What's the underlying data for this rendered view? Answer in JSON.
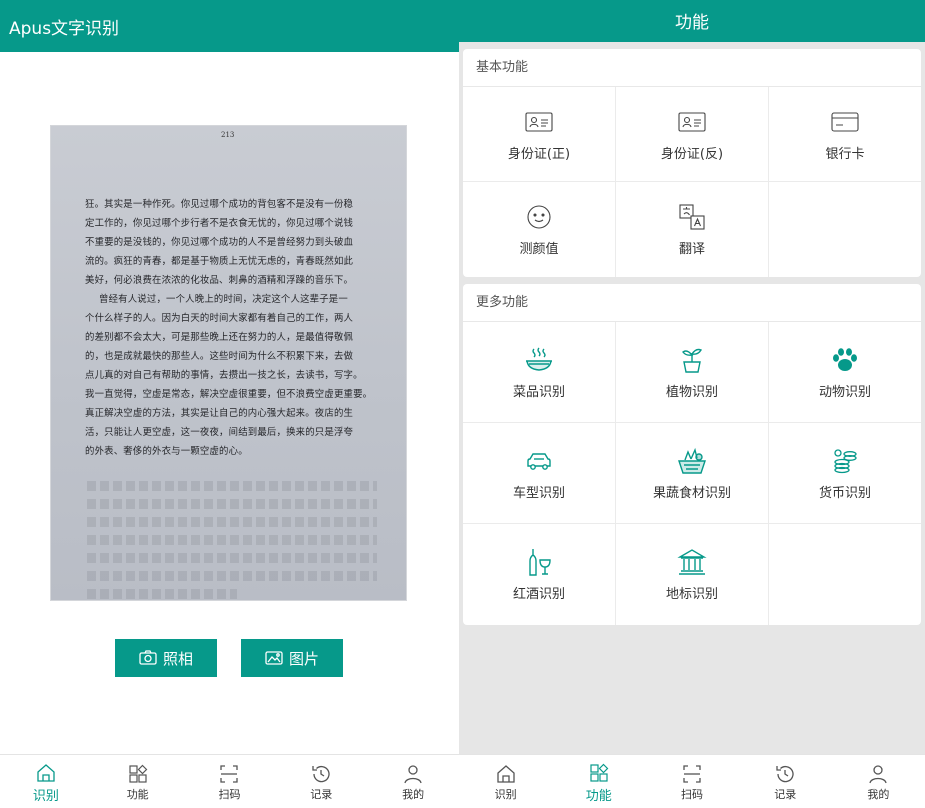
{
  "colors": {
    "accent": "#06998a",
    "panel_bg": "#e6e6e6"
  },
  "left": {
    "app_title": "Apus文字识别",
    "photo": {
      "page_number": "213",
      "lines": [
        "狂。其实是一种作死。你见过哪个成功的背包客不是没有一份稳",
        "定工作的，你见过哪个步行者不是衣食无忧的，你见过哪个说钱",
        "不重要的是没钱的，你见过哪个成功的人不是曾经努力到头破血",
        "流的。疯狂的青春，都是基于物质上无忧无虑的，青春既然如此",
        "美好，何必浪费在浓浓的化妆品、刺鼻的酒精和浮躁的音乐下。",
        "曾经有人说过，一个人晚上的时间，决定这个人这辈子是一",
        "个什么样子的人。因为白天的时间大家都有着自己的工作，两人",
        "的差别都不会太大，可是那些晚上还在努力的人，是最值得敬佩",
        "的，也是成就最快的那些人。这些时间为什么不积累下来，去做",
        "点儿真的对自己有帮助的事情，去攒出一技之长，去读书，写字。",
        "我一直觉得，空虚是常态，解决空虚很重要，但不浪费空虚更重要。",
        "真正解决空虚的方法，其实是让自己的内心强大起来。夜店的生",
        "活，只能让人更空虚，这一夜夜，间结到最后，换来的只是浮夸",
        "的外表、奢侈的外衣与一颗空虚的心。"
      ]
    },
    "buttons": {
      "camera": "照相",
      "picture": "图片"
    }
  },
  "tabs": [
    {
      "label": "识别",
      "icon": "home-icon"
    },
    {
      "label": "功能",
      "icon": "grid-icon"
    },
    {
      "label": "扫码",
      "icon": "scan-icon"
    },
    {
      "label": "记录",
      "icon": "history-icon"
    },
    {
      "label": "我的",
      "icon": "user-icon"
    }
  ],
  "right": {
    "page_title": "功能",
    "basic": {
      "title": "基本功能",
      "items": [
        {
          "label": "身份证(正)",
          "icon": "id-card-front-icon"
        },
        {
          "label": "身份证(反)",
          "icon": "id-card-back-icon"
        },
        {
          "label": "银行卡",
          "icon": "bank-card-icon"
        },
        {
          "label": "测颜值",
          "icon": "face-icon"
        },
        {
          "label": "翻译",
          "icon": "translate-icon"
        },
        {
          "label": "",
          "icon": ""
        }
      ]
    },
    "more": {
      "title": "更多功能",
      "items": [
        {
          "label": "菜品识别",
          "icon": "dish-icon"
        },
        {
          "label": "植物识别",
          "icon": "plant-icon"
        },
        {
          "label": "动物识别",
          "icon": "paw-icon"
        },
        {
          "label": "车型识别",
          "icon": "car-icon"
        },
        {
          "label": "果蔬食材识别",
          "icon": "vegetable-basket-icon"
        },
        {
          "label": "货币识别",
          "icon": "coins-icon"
        },
        {
          "label": "红酒识别",
          "icon": "wine-icon"
        },
        {
          "label": "地标识别",
          "icon": "landmark-icon"
        },
        {
          "label": "",
          "icon": ""
        }
      ]
    }
  }
}
